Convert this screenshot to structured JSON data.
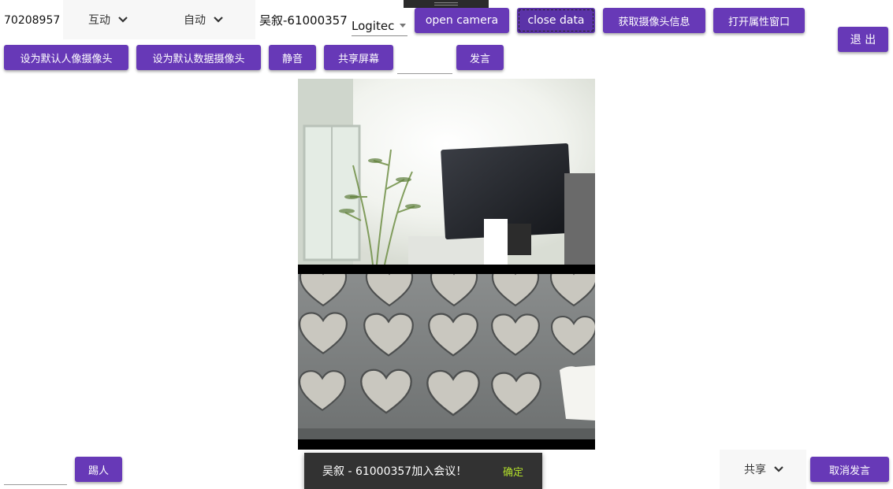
{
  "meeting": {
    "id": "70208957"
  },
  "controls": {
    "mode_dropdown": "互动",
    "auto_dropdown": "自动",
    "user_label": "吴叙-61000357",
    "device_select": "Logitec"
  },
  "toolbar": {
    "open_camera": "open camera",
    "close_data": "close data",
    "get_camera_info": "获取摄像头信息",
    "open_properties": "打开属性窗口",
    "exit": "退 出",
    "set_default_portrait": "设为默认人像摄像头",
    "set_default_data": "设为默认数据摄像头",
    "mute": "静音",
    "share_screen": "共享屏幕",
    "speak": "发言"
  },
  "bottom": {
    "kick": "踢人",
    "share_dropdown": "共享",
    "cancel_speak": "取消发言"
  },
  "snackbar": {
    "message": "吴叙 - 61000357加入会议！",
    "action": "确定"
  },
  "colors": {
    "accent": "#6739b7",
    "snackbar_bg": "#323232",
    "snackbar_action": "#b3e02b"
  }
}
